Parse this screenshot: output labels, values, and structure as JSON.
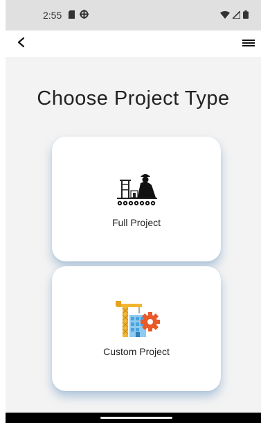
{
  "status_bar": {
    "time": "2:55",
    "left_icons": [
      "sd-card-icon",
      "vpn-icon"
    ],
    "right_icons": [
      "wifi-icon",
      "signal-icon",
      "battery-icon"
    ]
  },
  "app_bar": {
    "back_icon": "back-chevron-icon",
    "menu_icon": "hamburger-menu-icon"
  },
  "page": {
    "title": "Choose Project Type"
  },
  "cards": [
    {
      "label": "Full Project",
      "icon": "construction-worker-icon"
    },
    {
      "label": "Custom Project",
      "icon": "crane-building-gear-icon"
    }
  ],
  "colors": {
    "background": "#f3f3f3",
    "card_shadow": "#78a0c8",
    "status_bar": "#e0e0e0",
    "gear": "#e85a2a",
    "crane": "#f2b632",
    "building": "#4aa3df"
  }
}
